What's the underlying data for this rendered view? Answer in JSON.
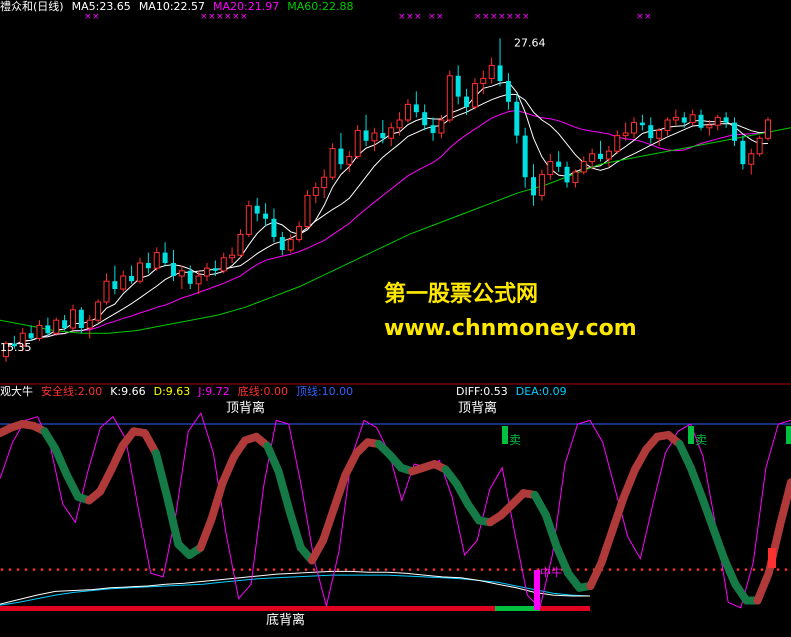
{
  "top_panel": {
    "stock_name_fragment": "禮众和(日线)",
    "ma_labels": [
      {
        "text": "MA5:23.65",
        "color": "#ffffff"
      },
      {
        "text": "MA10:22.57",
        "color": "#ffffff"
      },
      {
        "text": "MA20:21.97",
        "color": "#ff00ff"
      },
      {
        "text": "MA60:22.88",
        "color": "#00cc00"
      }
    ],
    "high_label": "27.64",
    "low_label": "15.35"
  },
  "bottom_panel": {
    "indicator_name": "观大牛",
    "labels_left": [
      {
        "text": "安全线:2.00",
        "color": "#ff3030"
      },
      {
        "text": "K:9.66",
        "color": "#ffffff"
      },
      {
        "text": "D:9.63",
        "color": "#ffff00"
      },
      {
        "text": "J:9.72",
        "color": "#ff00ff"
      },
      {
        "text": "底线:0.00",
        "color": "#ff3030"
      },
      {
        "text": "顶线:10.00",
        "color": "#3060ff"
      }
    ],
    "labels_right": [
      {
        "text": "DIFF:0.53",
        "color": "#ffffff"
      },
      {
        "text": "DEA:0.09",
        "color": "#00ccff"
      }
    ],
    "annotations": {
      "top_divergence": "顶背离",
      "bottom_divergence": "底背离",
      "sell": "卖",
      "hold": "中牛"
    }
  },
  "watermark": {
    "line1": "第一股票公式网",
    "line2": "www.chnmoney.com"
  },
  "chart_data": [
    {
      "type": "candlestick",
      "title": "",
      "ylim": [
        14.5,
        28.5
      ],
      "series": [
        {
          "name": "MA5",
          "color": "#ffffff"
        },
        {
          "name": "MA10",
          "color": "#ffffff"
        },
        {
          "name": "MA20",
          "color": "#ff00ff"
        },
        {
          "name": "MA60",
          "color": "#00cc00"
        }
      ],
      "candles": [
        [
          15.4,
          16.0,
          15.2,
          15.9
        ],
        [
          15.9,
          16.2,
          15.7,
          15.8
        ],
        [
          15.8,
          16.5,
          15.6,
          16.3
        ],
        [
          16.3,
          16.6,
          16.0,
          16.1
        ],
        [
          16.1,
          16.8,
          16.0,
          16.6
        ],
        [
          16.6,
          16.9,
          16.2,
          16.3
        ],
        [
          16.3,
          16.9,
          16.2,
          16.8
        ],
        [
          16.8,
          17.0,
          16.4,
          16.5
        ],
        [
          16.5,
          17.4,
          16.4,
          17.2
        ],
        [
          17.2,
          17.3,
          16.3,
          16.5
        ],
        [
          16.5,
          17.0,
          16.1,
          16.8
        ],
        [
          16.8,
          17.6,
          16.7,
          17.5
        ],
        [
          17.5,
          18.6,
          17.4,
          18.3
        ],
        [
          18.3,
          18.9,
          17.8,
          18.0
        ],
        [
          18.0,
          18.7,
          17.9,
          18.5
        ],
        [
          18.5,
          18.9,
          18.2,
          18.3
        ],
        [
          18.3,
          19.2,
          18.2,
          19.0
        ],
        [
          19.0,
          19.4,
          18.6,
          18.8
        ],
        [
          18.8,
          19.6,
          18.7,
          19.4
        ],
        [
          19.4,
          19.8,
          18.9,
          19.0
        ],
        [
          19.0,
          19.5,
          18.3,
          18.5
        ],
        [
          18.5,
          18.9,
          18.0,
          18.7
        ],
        [
          18.7,
          18.9,
          18.0,
          18.2
        ],
        [
          18.2,
          18.7,
          17.8,
          18.5
        ],
        [
          18.5,
          19.0,
          18.3,
          18.8
        ],
        [
          18.8,
          19.1,
          18.5,
          18.7
        ],
        [
          18.7,
          19.4,
          18.6,
          19.2
        ],
        [
          19.2,
          19.6,
          19.0,
          19.3
        ],
        [
          19.3,
          20.3,
          19.2,
          20.1
        ],
        [
          20.1,
          21.4,
          20.0,
          21.2
        ],
        [
          21.2,
          21.5,
          20.6,
          20.9
        ],
        [
          20.9,
          21.3,
          20.4,
          20.7
        ],
        [
          20.7,
          21.1,
          19.8,
          20.0
        ],
        [
          20.0,
          20.2,
          19.3,
          19.5
        ],
        [
          19.5,
          20.1,
          19.4,
          19.9
        ],
        [
          19.9,
          20.6,
          19.8,
          20.4
        ],
        [
          20.4,
          21.8,
          20.3,
          21.6
        ],
        [
          21.6,
          22.1,
          21.3,
          21.9
        ],
        [
          21.9,
          22.6,
          21.5,
          22.3
        ],
        [
          22.3,
          23.6,
          22.2,
          23.4
        ],
        [
          23.4,
          24.0,
          22.6,
          22.8
        ],
        [
          22.8,
          23.3,
          22.5,
          23.1
        ],
        [
          23.1,
          24.3,
          23.0,
          24.1
        ],
        [
          24.1,
          24.7,
          23.5,
          23.7
        ],
        [
          23.7,
          24.2,
          23.3,
          24.0
        ],
        [
          24.0,
          24.5,
          23.6,
          23.8
        ],
        [
          23.8,
          24.4,
          23.5,
          24.2
        ],
        [
          24.2,
          24.8,
          23.9,
          24.5
        ],
        [
          24.5,
          25.3,
          24.4,
          25.1
        ],
        [
          25.1,
          25.6,
          24.6,
          24.8
        ],
        [
          24.8,
          25.1,
          24.1,
          24.3
        ],
        [
          24.3,
          24.6,
          23.7,
          24.0
        ],
        [
          24.0,
          24.7,
          23.8,
          24.5
        ],
        [
          24.5,
          26.4,
          24.4,
          26.2
        ],
        [
          26.2,
          26.6,
          25.1,
          25.4
        ],
        [
          25.4,
          25.7,
          24.7,
          25.0
        ],
        [
          25.0,
          26.1,
          24.9,
          25.9
        ],
        [
          25.9,
          26.4,
          25.5,
          26.1
        ],
        [
          26.1,
          26.9,
          25.9,
          26.6
        ],
        [
          26.6,
          27.64,
          25.8,
          26.0
        ],
        [
          26.0,
          26.3,
          24.9,
          25.2
        ],
        [
          25.2,
          25.5,
          23.6,
          23.9
        ],
        [
          23.9,
          24.2,
          21.9,
          22.3
        ],
        [
          22.3,
          22.8,
          21.2,
          21.6
        ],
        [
          21.6,
          22.6,
          21.4,
          22.4
        ],
        [
          22.4,
          23.2,
          22.2,
          22.9
        ],
        [
          22.9,
          23.3,
          22.5,
          22.7
        ],
        [
          22.7,
          22.9,
          21.9,
          22.1
        ],
        [
          22.1,
          22.6,
          21.9,
          22.5
        ],
        [
          22.5,
          23.1,
          22.4,
          22.9
        ],
        [
          22.9,
          23.4,
          22.6,
          23.2
        ],
        [
          23.2,
          23.7,
          22.9,
          23.0
        ],
        [
          23.0,
          23.5,
          22.7,
          23.3
        ],
        [
          23.3,
          24.1,
          23.2,
          23.9
        ],
        [
          23.9,
          24.4,
          23.7,
          24.0
        ],
        [
          24.0,
          24.6,
          23.8,
          24.4
        ],
        [
          24.4,
          24.7,
          24.1,
          24.3
        ],
        [
          24.3,
          24.6,
          23.6,
          23.8
        ],
        [
          23.8,
          24.2,
          23.5,
          24.1
        ],
        [
          24.1,
          24.6,
          23.9,
          24.5
        ],
        [
          24.5,
          24.9,
          24.3,
          24.6
        ],
        [
          24.6,
          24.8,
          24.2,
          24.4
        ],
        [
          24.4,
          24.9,
          24.3,
          24.7
        ],
        [
          24.7,
          24.9,
          24.1,
          24.2
        ],
        [
          24.2,
          24.5,
          23.9,
          24.3
        ],
        [
          24.3,
          24.7,
          24.1,
          24.6
        ],
        [
          24.6,
          24.8,
          24.2,
          24.4
        ],
        [
          24.4,
          24.6,
          23.5,
          23.7
        ],
        [
          23.7,
          23.9,
          22.6,
          22.8
        ],
        [
          22.8,
          23.4,
          22.4,
          23.2
        ],
        [
          23.2,
          23.9,
          23.1,
          23.8
        ],
        [
          23.8,
          24.6,
          23.7,
          24.5
        ]
      ],
      "ma60": [
        16.8,
        16.6,
        16.4,
        16.3,
        16.3,
        16.4,
        16.6,
        16.8,
        17.0,
        17.3,
        17.7,
        18.1,
        18.6,
        19.1,
        19.6,
        20.1,
        20.5,
        20.9,
        21.3,
        21.7,
        22.0,
        22.4,
        22.8,
        23.0,
        23.2,
        23.4,
        23.6,
        23.8,
        24.0,
        24.2
      ]
    },
    {
      "type": "line",
      "title": "",
      "ylim": [
        -0.5,
        11.0
      ],
      "reference_lines": [
        {
          "name": "安全线",
          "value": 2.0,
          "color": "#ff3030",
          "style": "dotted"
        },
        {
          "name": "底线",
          "value": 0.0,
          "color": "#ff3030"
        },
        {
          "name": "顶线",
          "value": 10.0,
          "color": "#3060ff"
        }
      ],
      "series": [
        {
          "name": "K",
          "color": "#ffffff"
        },
        {
          "name": "D",
          "color": "#ffff00"
        },
        {
          "name": "J",
          "color": "#ff00ff"
        },
        {
          "name": "DIFF",
          "color": "#ffffff"
        },
        {
          "name": "DEA",
          "color": "#00ccff"
        }
      ],
      "main_curve": [
        9.5,
        9.8,
        10.0,
        9.9,
        9.6,
        8.6,
        7.2,
        6.0,
        5.8,
        6.3,
        7.5,
        8.8,
        9.6,
        9.5,
        8.4,
        6.0,
        3.4,
        2.8,
        3.2,
        4.8,
        6.8,
        8.2,
        9.1,
        9.3,
        8.8,
        7.4,
        5.2,
        3.2,
        2.5,
        3.6,
        5.4,
        7.2,
        8.4,
        9.0,
        8.9,
        8.3,
        7.6,
        7.4,
        7.6,
        7.8,
        7.5,
        6.7,
        5.6,
        4.7,
        4.6,
        5.0,
        5.6,
        6.2,
        6.1,
        5.0,
        3.2,
        1.8,
        1.0,
        1.1,
        2.4,
        4.2,
        6.0,
        7.5,
        8.6,
        9.3,
        9.4,
        8.9,
        7.6,
        6.0,
        4.3,
        2.6,
        1.2,
        0.3,
        0.3,
        1.8,
        4.4,
        6.8
      ],
      "main_curve_colors": [
        "r",
        "r",
        "r",
        "r",
        "g",
        "g",
        "g",
        "g",
        "r",
        "r",
        "r",
        "r",
        "r",
        "r",
        "g",
        "g",
        "g",
        "g",
        "r",
        "r",
        "r",
        "r",
        "r",
        "r",
        "g",
        "g",
        "g",
        "g",
        "r",
        "r",
        "r",
        "r",
        "r",
        "r",
        "g",
        "g",
        "g",
        "r",
        "r",
        "r",
        "g",
        "g",
        "g",
        "g",
        "r",
        "r",
        "r",
        "r",
        "g",
        "g",
        "g",
        "g",
        "g",
        "r",
        "r",
        "r",
        "r",
        "r",
        "r",
        "r",
        "r",
        "g",
        "g",
        "g",
        "g",
        "g",
        "g",
        "g",
        "r",
        "r",
        "r",
        "r"
      ],
      "j_line": [
        7.0,
        9.0,
        10.2,
        10.4,
        8.8,
        5.6,
        4.6,
        7.4,
        9.8,
        10.4,
        9.2,
        5.4,
        1.8,
        1.6,
        5.0,
        9.6,
        10.6,
        8.4,
        4.0,
        0.4,
        1.2,
        6.6,
        10.2,
        10.0,
        6.6,
        2.6,
        0.0,
        3.0,
        8.2,
        10.2,
        9.8,
        8.4,
        5.8,
        7.8,
        7.6,
        8.0,
        6.0,
        2.8,
        3.6,
        6.4,
        7.6,
        4.0,
        0.6,
        -0.1,
        2.8,
        7.8,
        10.0,
        10.2,
        9.0,
        6.4,
        3.8,
        2.6,
        5.6,
        8.4,
        9.6,
        10.0,
        8.2,
        4.4,
        0.2,
        -0.1,
        2.4,
        7.6,
        10.0,
        10.2
      ],
      "diff_line": [
        0.1,
        0.35,
        0.6,
        0.8,
        0.85,
        0.9,
        1.0,
        1.05,
        1.1,
        1.2,
        1.25,
        1.35,
        1.45,
        1.55,
        1.65,
        1.75,
        1.8,
        1.85,
        1.9,
        1.9,
        1.85,
        1.85,
        1.8,
        1.7,
        1.6,
        1.55,
        1.4,
        1.2,
        1.0,
        0.75,
        0.6,
        0.55,
        0.55
      ],
      "dea_line": [
        0.05,
        0.2,
        0.4,
        0.6,
        0.75,
        0.85,
        0.95,
        1.0,
        1.05,
        1.1,
        1.15,
        1.2,
        1.3,
        1.4,
        1.5,
        1.55,
        1.6,
        1.65,
        1.7,
        1.7,
        1.7,
        1.7,
        1.65,
        1.6,
        1.55,
        1.5,
        1.4,
        1.3,
        1.1,
        0.9,
        0.7,
        0.6,
        0.55
      ]
    }
  ]
}
